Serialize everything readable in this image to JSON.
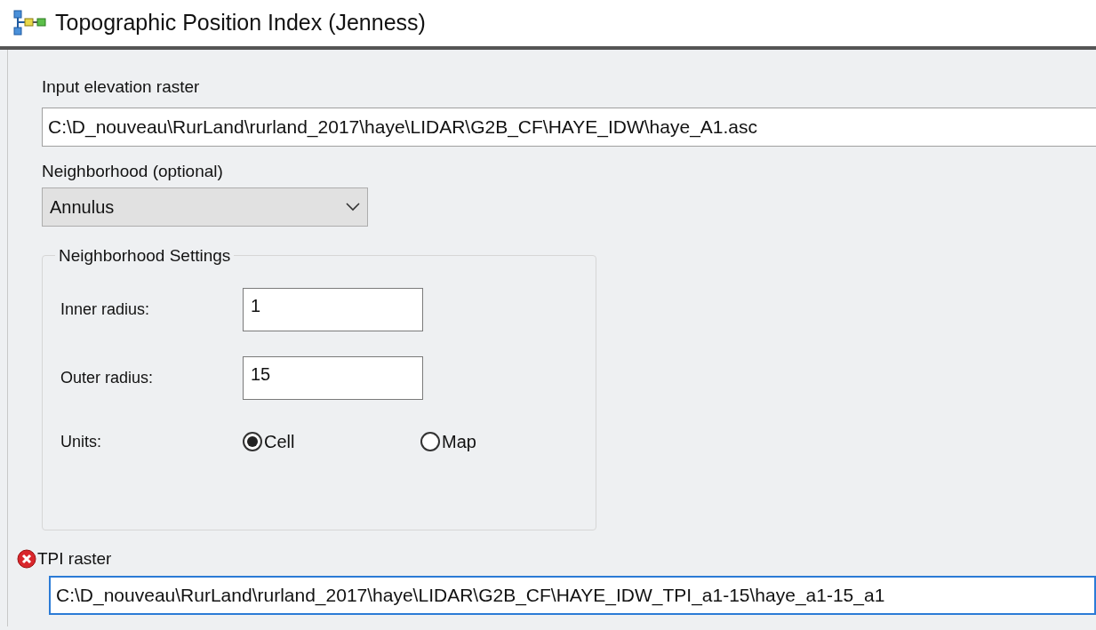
{
  "window": {
    "title": "Topographic Position Index (Jenness)"
  },
  "fields": [
    {
      "label": "Input elevation raster",
      "value": "C:\\D_nouveau\\RurLand\\rurland_2017\\haye\\LIDAR\\G2B_CF\\HAYE_IDW\\haye_A1.asc"
    },
    {
      "label": "Neighborhood (optional)",
      "kind": "dropdown",
      "value": "Annulus"
    }
  ],
  "neighborhood_settings": {
    "title": "Neighborhood Settings",
    "inputs": [
      {
        "label": "Inner radius:",
        "value": "1"
      },
      {
        "label": "Outer radius:",
        "value": "15"
      }
    ],
    "units": {
      "label": "Units:",
      "options": [
        {
          "label": "Cell",
          "selected": true
        },
        {
          "label": "Map",
          "selected": false
        }
      ]
    }
  },
  "output": {
    "label": "TPI raster",
    "value": "C:\\D_nouveau\\RurLand\\rurland_2017\\haye\\LIDAR\\G2B_CF\\HAYE_IDW_TPI_a1-15\\haye_a1-15_a1",
    "error": true,
    "focused": true
  }
}
